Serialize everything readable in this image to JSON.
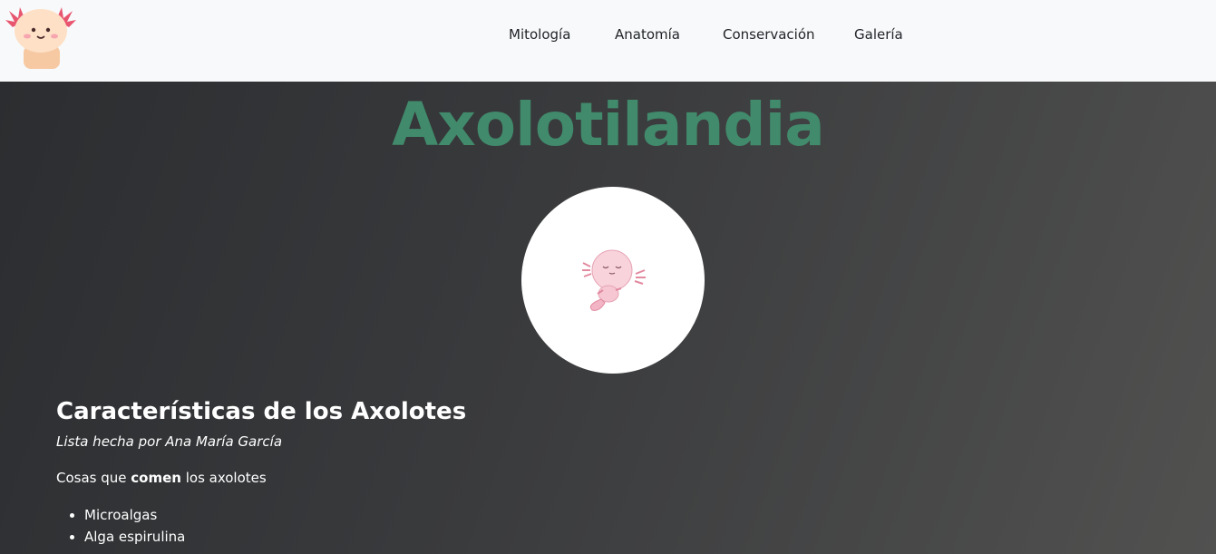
{
  "nav": {
    "logo_icon": "axolotl-logo-icon",
    "links": [
      "Mitología",
      "Anatomía",
      "Conservación",
      "Galería"
    ]
  },
  "hero": {
    "title": "Axolotilandia",
    "image_icon": "axolotl-illustration-icon"
  },
  "section": {
    "heading": "Características de los Axolotes",
    "byline": "Lista hecha por Ana María García",
    "intro_before": "Cosas que ",
    "intro_bold": "comen",
    "intro_after": " los axolotes",
    "items": [
      "Microalgas",
      "Alga espirulina"
    ]
  },
  "colors": {
    "title": "#418a6c",
    "navbar": "#f8f9fa",
    "hero_dark": "#2b2d30",
    "hero_light": "#515150"
  }
}
